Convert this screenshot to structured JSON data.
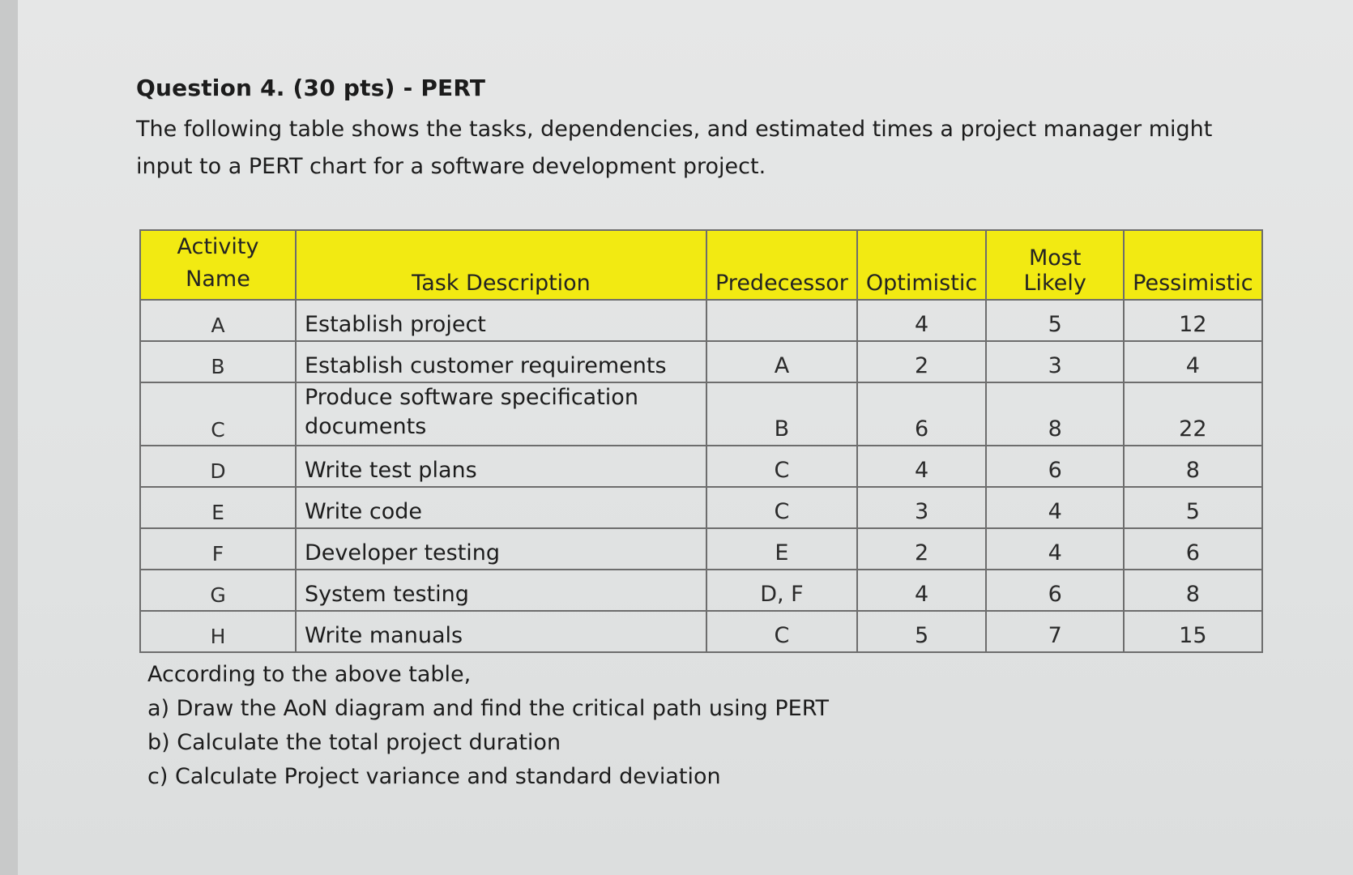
{
  "question": {
    "title": "Question 4. (30 pts)",
    "topic": "- PERT",
    "intro": "The following table shows the tasks, dependencies, and estimated times a project manager might input to a PERT chart for a software development project."
  },
  "table": {
    "headers": {
      "activity_line1": "Activity",
      "activity_line2": "Name",
      "task": "Task Description",
      "predecessor": "Predecessor",
      "optimistic": "Optimistic",
      "most_likely": "Most Likely",
      "pessimistic": "Pessimistic"
    },
    "rows": [
      {
        "activity": "A",
        "task": "Establish project",
        "predecessor": "",
        "optimistic": "4",
        "most_likely": "5",
        "pessimistic": "12"
      },
      {
        "activity": "B",
        "task": "Establish customer requirements",
        "predecessor": "A",
        "optimistic": "2",
        "most_likely": "3",
        "pessimistic": "4"
      },
      {
        "activity": "C",
        "task": "Produce software specification documents",
        "predecessor": "B",
        "optimistic": "6",
        "most_likely": "8",
        "pessimistic": "22"
      },
      {
        "activity": "D",
        "task": "Write test plans",
        "predecessor": "C",
        "optimistic": "4",
        "most_likely": "6",
        "pessimistic": "8"
      },
      {
        "activity": "E",
        "task": "Write code",
        "predecessor": "C",
        "optimistic": "3",
        "most_likely": "4",
        "pessimistic": "5"
      },
      {
        "activity": "F",
        "task": "Developer testing",
        "predecessor": "E",
        "optimistic": "2",
        "most_likely": "4",
        "pessimistic": "6"
      },
      {
        "activity": "G",
        "task": "System testing",
        "predecessor": "D, F",
        "optimistic": "4",
        "most_likely": "6",
        "pessimistic": "8"
      },
      {
        "activity": "H",
        "task": "Write manuals",
        "predecessor": "C",
        "optimistic": "5",
        "most_likely": "7",
        "pessimistic": "15"
      }
    ]
  },
  "prompts": {
    "lead": "According to the above table,",
    "a": "a) Draw the AoN diagram and find the critical path using PERT",
    "b": "b) Calculate the total project duration",
    "c": "c) Calculate Project variance and standard deviation"
  }
}
